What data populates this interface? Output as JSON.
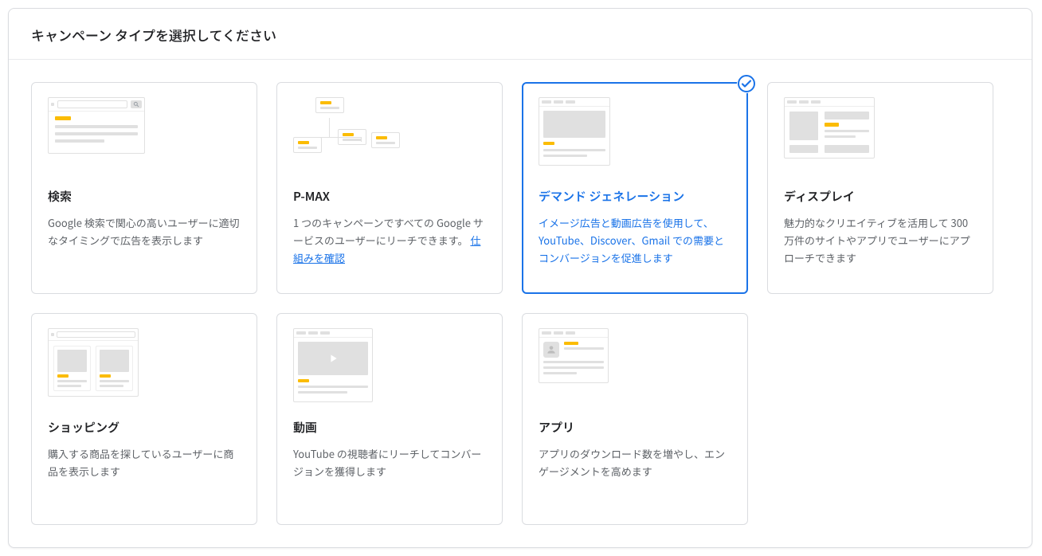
{
  "header": {
    "title": "キャンペーン タイプを選択してください"
  },
  "link_label": "仕組みを確認",
  "campaigns": [
    {
      "id": "search",
      "title": "検索",
      "desc": "Google 検索で関心の高いユーザーに適切なタイミングで広告を表示します",
      "selected": false,
      "has_link": false
    },
    {
      "id": "pmax",
      "title": "P-MAX",
      "desc": "1 つのキャンペーンですべての Google サービスのユーザーにリーチできます。",
      "selected": false,
      "has_link": true
    },
    {
      "id": "demand",
      "title": "デマンド ジェネレーション",
      "desc": "イメージ広告と動画広告を使用して、YouTube、Discover、Gmail での需要とコンバージョンを促進します",
      "selected": true,
      "has_link": false
    },
    {
      "id": "display",
      "title": "ディスプレイ",
      "desc": "魅力的なクリエイティブを活用して 300 万件のサイトやアプリでユーザーにアプローチできます",
      "selected": false,
      "has_link": false
    },
    {
      "id": "shopping",
      "title": "ショッピング",
      "desc": "購入する商品を探しているユーザーに商品を表示します",
      "selected": false,
      "has_link": false
    },
    {
      "id": "video",
      "title": "動画",
      "desc": "YouTube の視聴者にリーチしてコンバージョンを獲得します",
      "selected": false,
      "has_link": false
    },
    {
      "id": "app",
      "title": "アプリ",
      "desc": "アプリのダウンロード数を増やし、エンゲージメントを高めます",
      "selected": false,
      "has_link": false
    }
  ]
}
